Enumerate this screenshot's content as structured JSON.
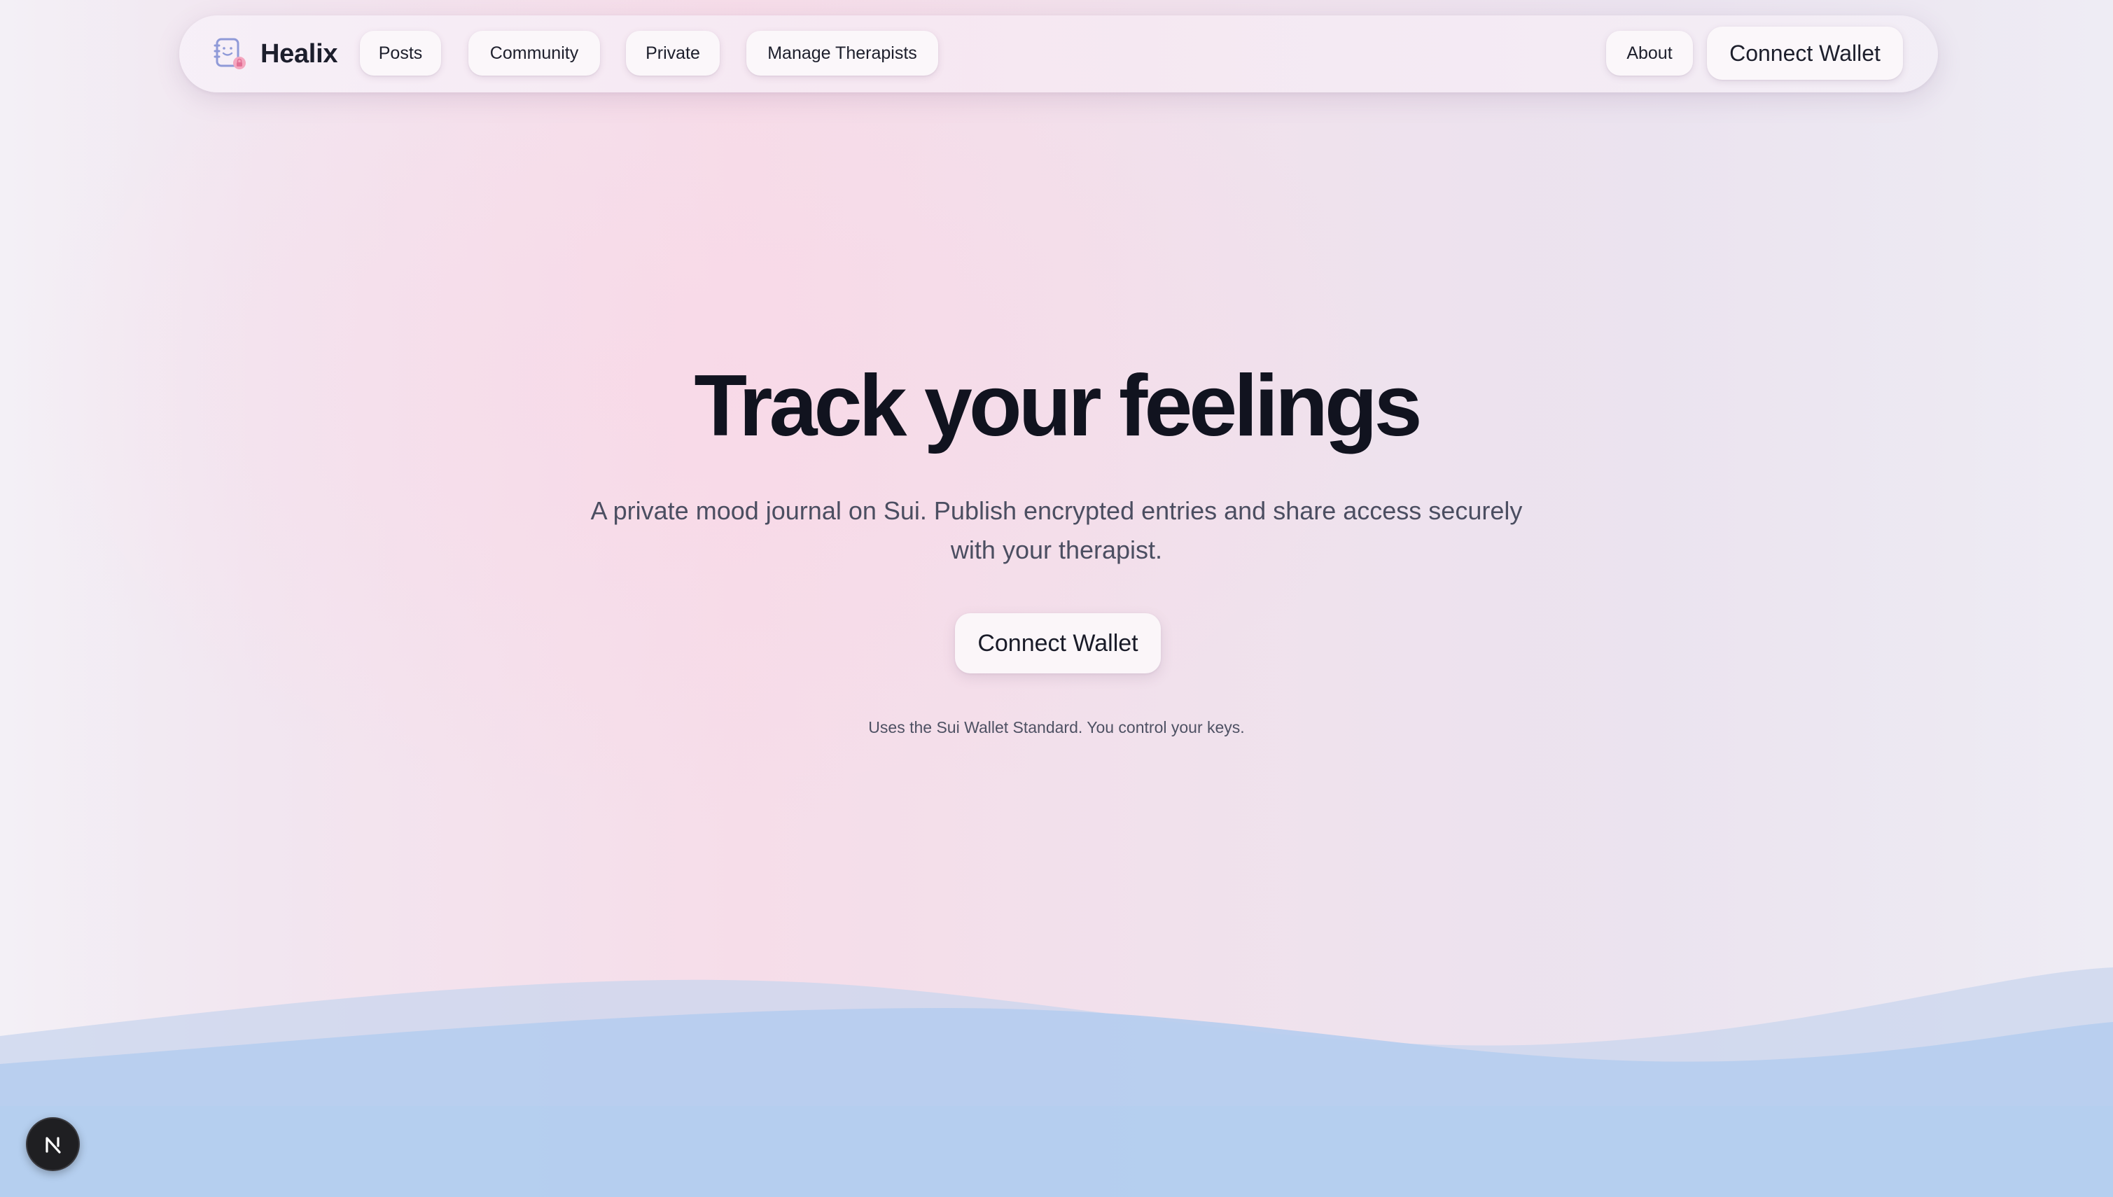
{
  "navbar": {
    "brand_name": "Healix",
    "brand_icon": "journal-lock-icon",
    "links": [
      {
        "label": "Posts"
      },
      {
        "label": "Community"
      },
      {
        "label": "Private"
      },
      {
        "label": "Manage Therapists"
      }
    ],
    "about_label": "About",
    "connect_label": "Connect Wallet"
  },
  "hero": {
    "title": "Track your feelings",
    "subtitle_line1": "A private mood journal on Sui. Publish encrypted entries and share access securely",
    "subtitle_line2": "with your therapist.",
    "cta_label": "Connect Wallet",
    "note": "Uses the Sui Wallet Standard. You control your keys."
  },
  "dev_badge": {
    "icon": "nextjs-icon"
  },
  "colors": {
    "text_primary": "#11131f",
    "text_secondary": "#4b4e61",
    "wave_back": "#c9d6ee",
    "wave_front": "#b6cdee"
  }
}
